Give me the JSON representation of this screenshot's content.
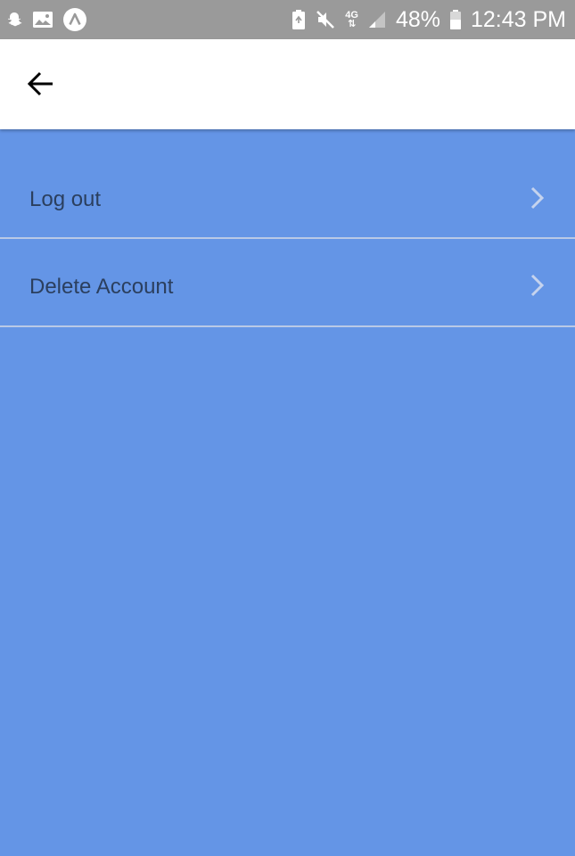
{
  "status_bar": {
    "battery_percent": "48%",
    "time": "12:43 PM",
    "network": "4G"
  },
  "app_bar": {
    "back_icon": "arrow-left-icon"
  },
  "menu": {
    "items": [
      {
        "label": "Log out",
        "icon": "chevron-right-icon"
      },
      {
        "label": "Delete Account",
        "icon": "chevron-right-icon"
      }
    ]
  },
  "colors": {
    "background": "#6495e6",
    "status_bar": "#9a9a9a",
    "app_bar": "#ffffff",
    "item_text": "#2b3f5e",
    "divider": "#b9c9e6",
    "chevron": "#c5d3ee"
  }
}
